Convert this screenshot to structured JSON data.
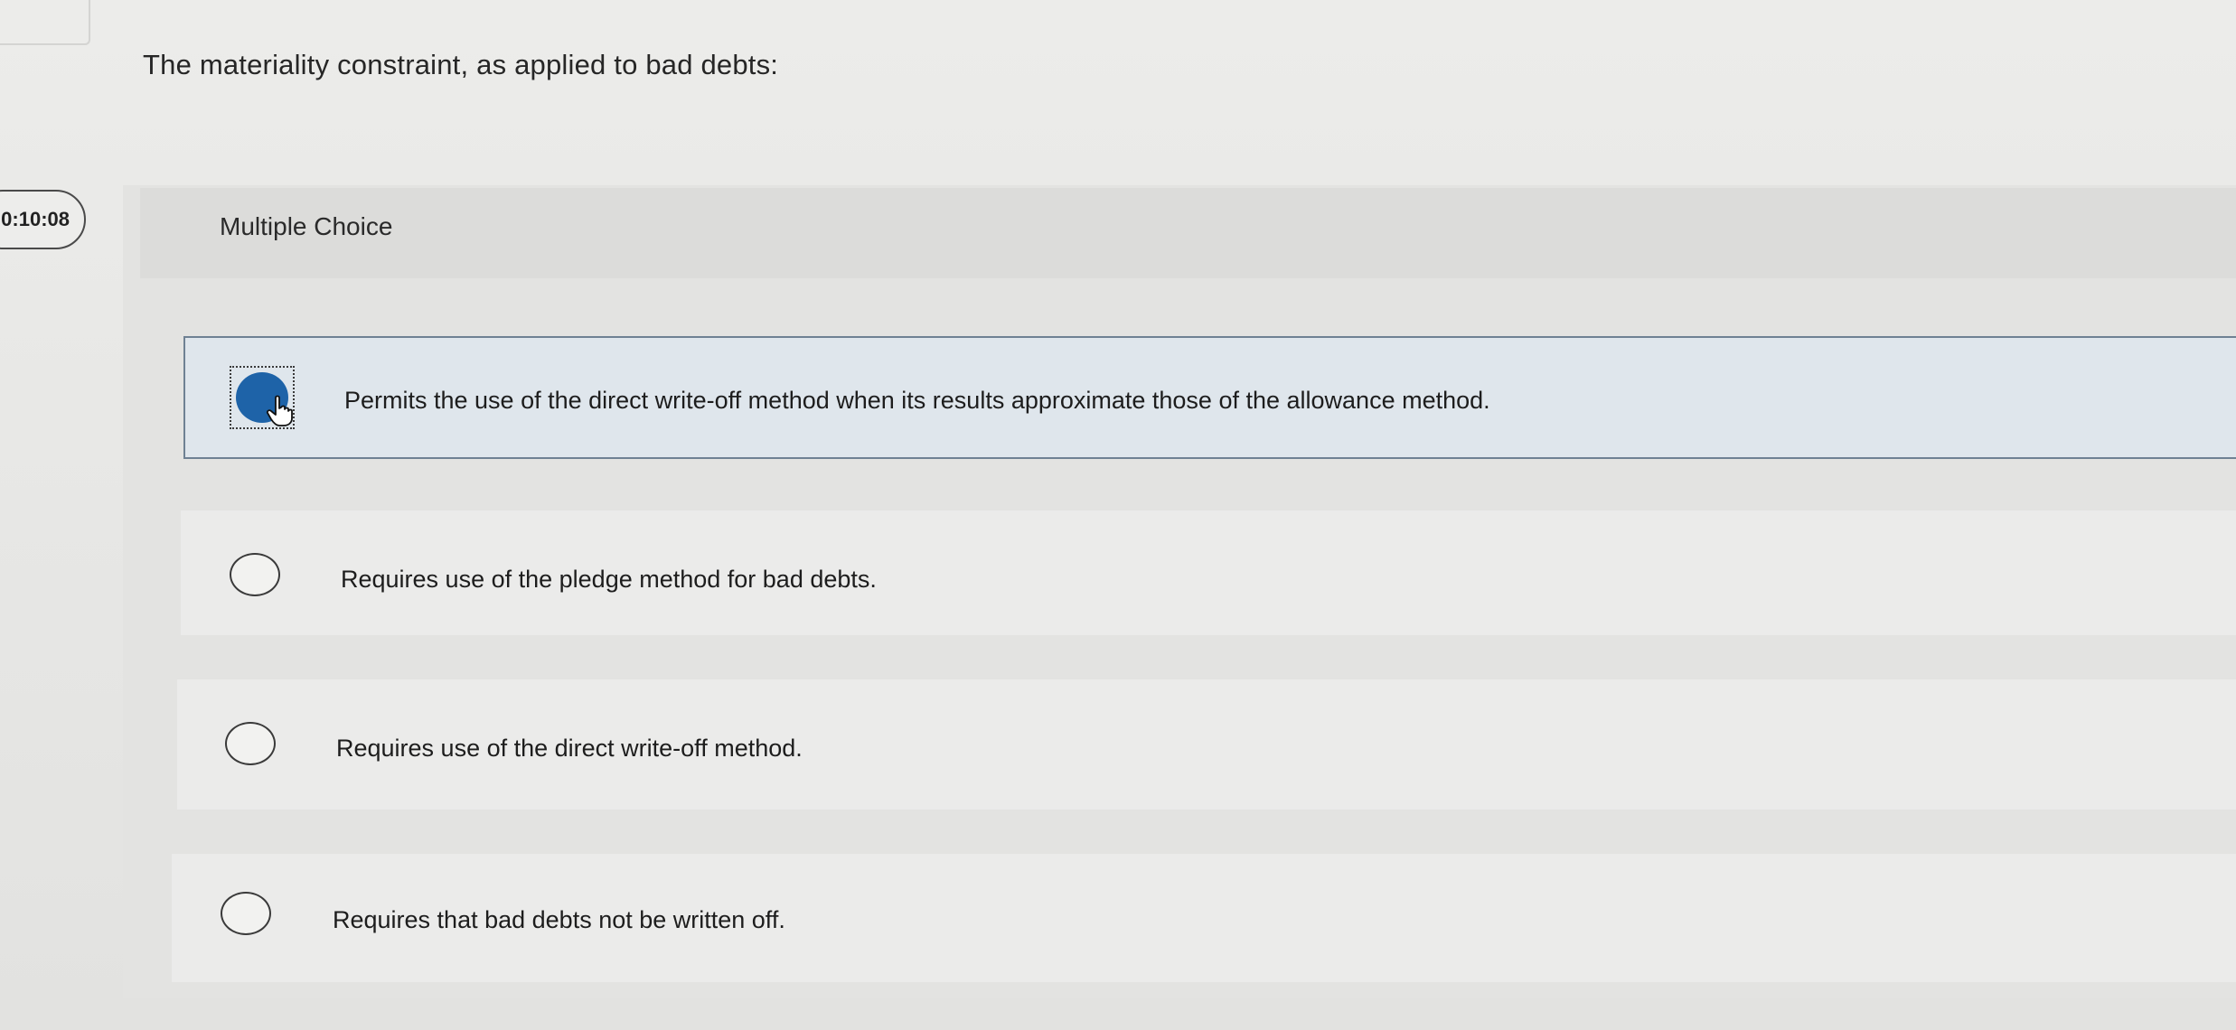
{
  "timer": {
    "value": "0:10:08"
  },
  "question": {
    "text": "The materiality constraint, as applied to bad debts:"
  },
  "section": {
    "label": "Multiple Choice"
  },
  "options": [
    {
      "text": "Permits the use of the direct write-off method when its results approximate those of the allowance method.",
      "selected": true
    },
    {
      "text": "Requires use of the pledge method for bad debts.",
      "selected": false
    },
    {
      "text": "Requires use of the direct write-off method.",
      "selected": false
    },
    {
      "text": "Requires that bad debts not be written off.",
      "selected": false
    }
  ],
  "icons": {
    "cursor": "hand-pointer-icon",
    "radio": "radio-button-icon"
  },
  "colors": {
    "selected_fill": "#1e63a8",
    "selected_bg": "#dfe6ec",
    "border": "#6f8193"
  }
}
